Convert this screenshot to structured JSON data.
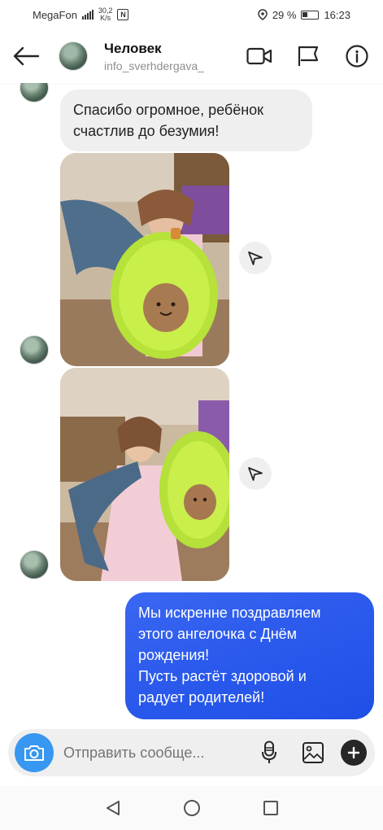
{
  "status_bar": {
    "carrier": "MegaFon",
    "network_speed_value": "30,2",
    "network_speed_unit": "K/s",
    "battery_percent": "29 %",
    "time": "16:23"
  },
  "header": {
    "name": "Человек",
    "username": "info_sverhdergava_"
  },
  "messages": {
    "incoming_text": "Спасибо огромное, ребёнок счастлив до безумия!",
    "outgoing_lines": [
      "Мы искренне поздравляем",
      "этого ангелочка с Днём",
      "рождения!",
      "Пусть растёт здоровой и",
      "радует родителей!"
    ]
  },
  "composer": {
    "placeholder": "Отправить сообще..."
  },
  "colors": {
    "outgoing_bubble": "#2a59ec",
    "incoming_bubble": "#efefef",
    "camera_button": "#3897f0"
  }
}
